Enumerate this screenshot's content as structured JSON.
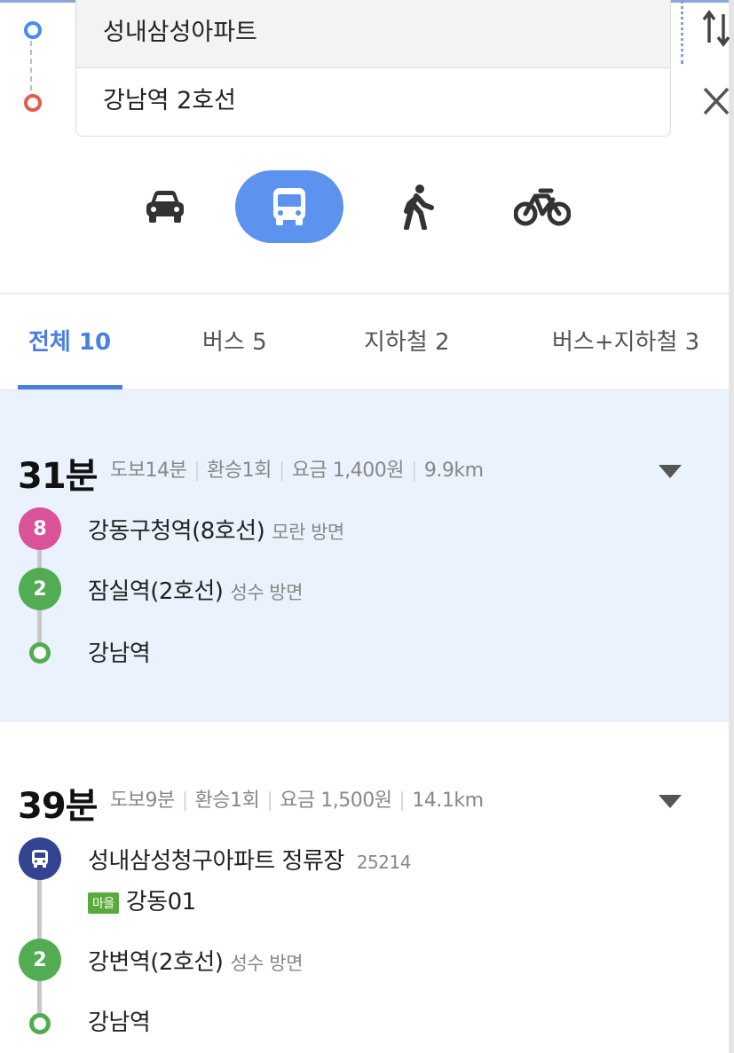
{
  "search": {
    "origin": "성내삼성아파트",
    "destination": "강남역 2호선"
  },
  "modes": [
    {
      "name": "car",
      "icon": "car-icon"
    },
    {
      "name": "transit",
      "icon": "bus-icon",
      "selected": true
    },
    {
      "name": "walk",
      "icon": "walk-icon"
    },
    {
      "name": "bike",
      "icon": "bike-icon"
    }
  ],
  "tabs": [
    "전체 10",
    "버스 5",
    "지하철 2",
    "버스+지하철 3"
  ],
  "routes": [
    {
      "time": "31분",
      "walk": "도보14분",
      "transfer": "환승1회",
      "fare": "요금 1,400원",
      "distance": "9.9km",
      "steps": [
        {
          "badge": "8",
          "name": "강동구청역(8호선)",
          "direction": "모란 방면"
        },
        {
          "badge": "2",
          "name": "잠실역(2호선)",
          "direction": "성수 방면"
        },
        {
          "name": "강남역"
        }
      ]
    },
    {
      "time": "39분",
      "walk": "도보9분",
      "transfer": "환승1회",
      "fare": "요금 1,500원",
      "distance": "14.1km",
      "steps": [
        {
          "name": "성내삼성청구아파트 정류장",
          "code": "25214",
          "bus_type": "마을",
          "bus_no": "강동01"
        },
        {
          "badge": "2",
          "name": "강변역(2호선)",
          "direction": "성수 방면"
        },
        {
          "name": "강남역"
        }
      ]
    }
  ],
  "colors": {
    "accent": "#4a7fe0",
    "line8": "#d9529a",
    "line2": "#52ad52",
    "bus": "#334591",
    "village_bus": "#5aab3c",
    "selected_card": "#eaf3fd"
  }
}
